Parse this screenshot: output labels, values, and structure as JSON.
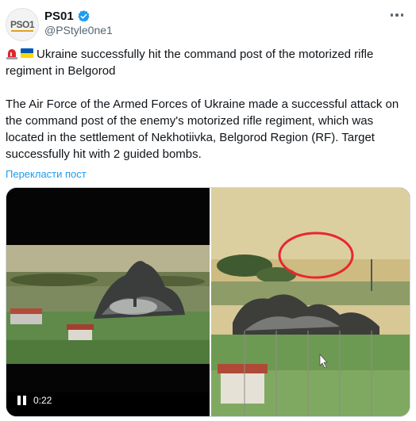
{
  "author": {
    "display_name": "PS01",
    "handle": "@PStyle0ne1",
    "avatar_text": "PSO1"
  },
  "tweet": {
    "lines": [
      "Ukraine successfully hit the command post of the motorized rifle",
      "regiment in Belgorod",
      "The Air Force of the Armed Forces of Ukraine made a successful attack on",
      "the command post of the enemy's motorized rifle regiment, which was",
      "located in the settlement of Nekhotiivka, Belgorod Region (RF). Target",
      "successfully hit with 2 guided bombs."
    ],
    "translate_label": "Перекласти пост"
  },
  "video": {
    "timestamp": "0:22"
  },
  "colors": {
    "link": "#1d9bf0",
    "verified": "#1d9bf0",
    "secondary_text": "#536471",
    "ua_blue": "#0057b7",
    "ua_yellow": "#ffd700",
    "annotation_circle": "#e8272e"
  },
  "icons": {
    "verified": "verified-badge-icon",
    "more": "more-dots-icon",
    "siren": "siren-emoji-icon",
    "flag": "ukraine-flag-icon",
    "pause": "pause-icon"
  }
}
